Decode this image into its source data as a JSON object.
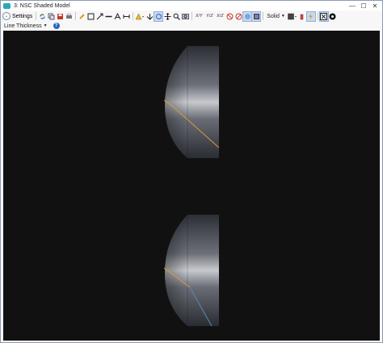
{
  "window": {
    "title": "3: NSC Shaded Model",
    "controls": {
      "minimize": "—",
      "maximize": "☐",
      "close": "✕"
    }
  },
  "toolbar": {
    "settings_label": "Settings",
    "axis_buttons": [
      "X/Y",
      "Y/Z",
      "X/Z"
    ],
    "render_mode": "Solid",
    "line_thickness_label": "Line Thickness"
  },
  "colors": {
    "viewport_bg": "#111111",
    "ray_orange": "#d89a3a",
    "ray_blue": "#4f8fb8",
    "lens_body": "#5a5d66"
  },
  "icons": [
    "refresh-icon",
    "copy-icon",
    "save-icon",
    "print-icon",
    "pencil-icon",
    "rectangle-icon",
    "arrow-icon",
    "line-icon",
    "text-icon",
    "dimension-icon",
    "rotate-icon",
    "pan-icon",
    "zoom-icon",
    "zoom-window-icon"
  ]
}
